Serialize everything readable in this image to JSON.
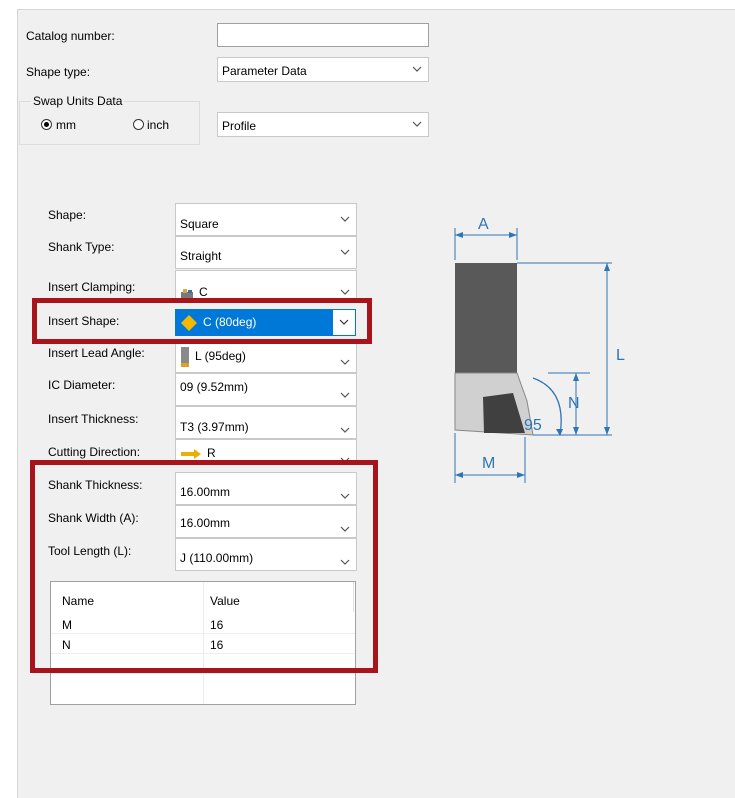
{
  "header": {
    "catalog_label": "Catalog number:",
    "catalog_value": "",
    "shape_type_label": "Shape type:",
    "shape_type_value": "Parameter Data",
    "swap_units_title": "Swap Units Data",
    "unit_mm": "mm",
    "unit_inch": "inch",
    "selected_unit": "mm",
    "profile_value": "Profile"
  },
  "params": {
    "shape": {
      "label": "Shape:",
      "value": "Square"
    },
    "shank_type": {
      "label": "Shank Type:",
      "value": "Straight"
    },
    "insert_clamping": {
      "label": "Insert Clamping:",
      "value": "C"
    },
    "insert_shape": {
      "label": "Insert Shape:",
      "value": "C (80deg)"
    },
    "insert_lead_angle": {
      "label": "Insert Lead Angle:",
      "value": "L (95deg)"
    },
    "ic_diameter": {
      "label": "IC Diameter:",
      "value": "09 (9.52mm)"
    },
    "insert_thickness": {
      "label": "Insert Thickness:",
      "value": "T3 (3.97mm)"
    },
    "cutting_direction": {
      "label": "Cutting Direction:",
      "value": "R"
    },
    "shank_thickness": {
      "label": "Shank Thickness:",
      "value": "16.00mm"
    },
    "shank_width": {
      "label": "Shank Width (A):",
      "value": "16.00mm"
    },
    "tool_length": {
      "label": "Tool Length (L):",
      "value": "J (110.00mm)"
    }
  },
  "table": {
    "columns": [
      "Name",
      "Value"
    ],
    "rows": [
      {
        "name": "M",
        "value": "16"
      },
      {
        "name": "N",
        "value": "16"
      }
    ]
  },
  "diagram": {
    "label_a": "A",
    "label_l": "L",
    "label_n": "N",
    "label_m": "M",
    "angle": "95"
  },
  "colors": {
    "accent": "#0078d7",
    "highlight_box": "#a8141c",
    "dimension": "#2e75b6"
  }
}
